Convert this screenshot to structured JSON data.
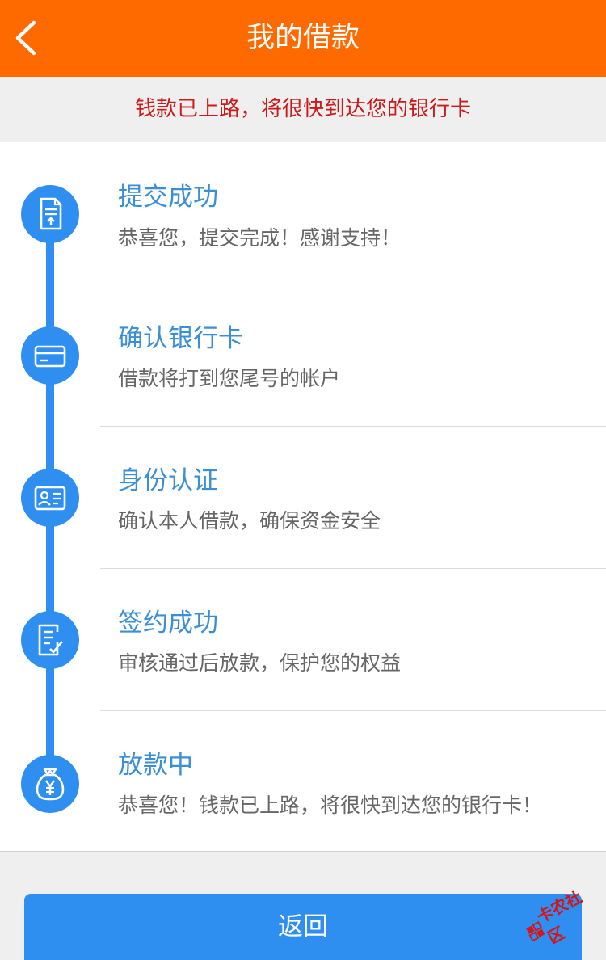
{
  "header": {
    "title": "我的借款",
    "back_icon": "chevron-left-icon",
    "background_color": "#ff6a00"
  },
  "notice": {
    "text": "钱款已上路，将很快到达您的银行卡",
    "color": "#cc1a1a"
  },
  "steps": [
    {
      "title": "提交成功",
      "desc": "恭喜您，提交完成！感谢支持！",
      "icon": "document-upload-icon"
    },
    {
      "title": "确认银行卡",
      "desc": "借款将打到您尾号的帐户",
      "icon": "bank-card-icon"
    },
    {
      "title": "身份认证",
      "desc": "确认本人借款，确保资金安全",
      "icon": "id-card-icon"
    },
    {
      "title": "签约成功",
      "desc": "审核通过后放款，保护您的权益",
      "icon": "contract-sign-icon"
    },
    {
      "title": "放款中",
      "desc": "恭喜您！钱款已上路，将很快到达您的银行卡！",
      "icon": "money-bag-icon"
    }
  ],
  "accent_color": "#2f8ff0",
  "return_button": {
    "label": "返回"
  },
  "watermark": {
    "text": "卡农社区"
  }
}
